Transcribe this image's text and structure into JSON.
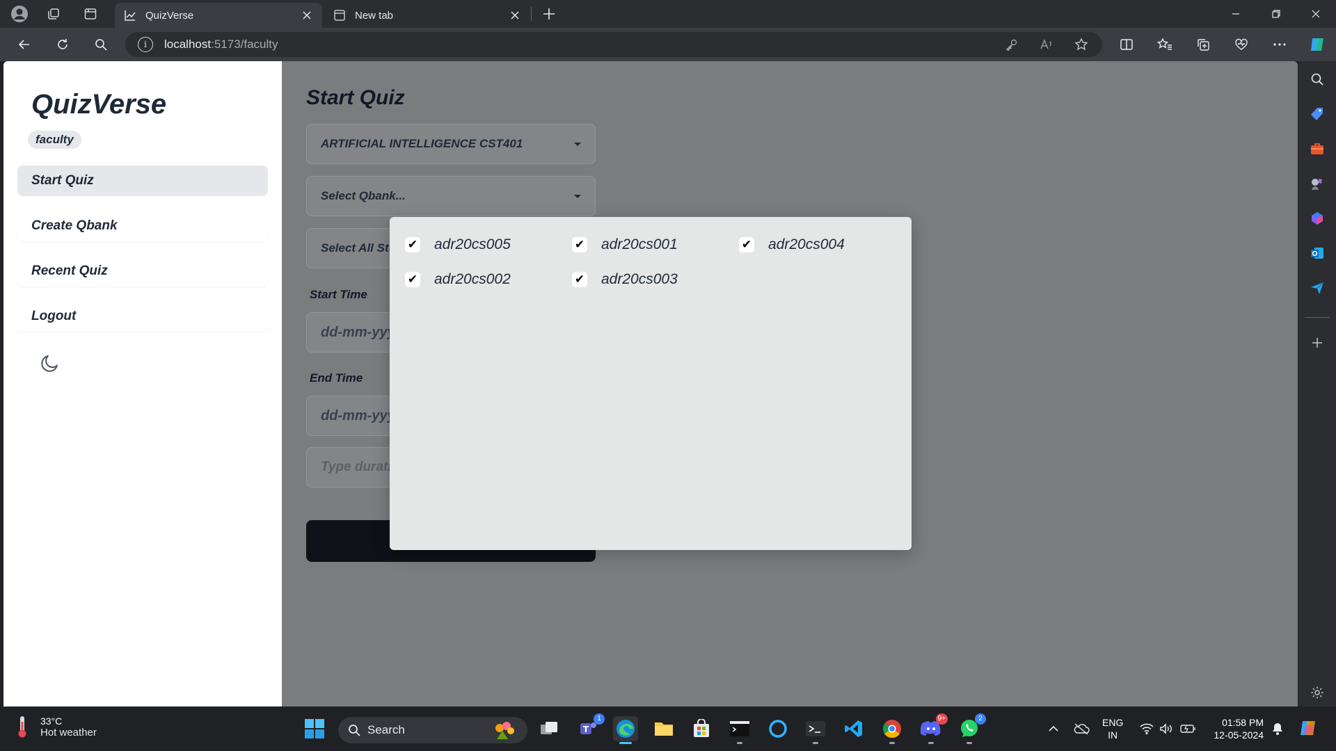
{
  "browser": {
    "tabs": [
      {
        "title": "QuizVerse",
        "active": true
      },
      {
        "title": "New tab",
        "active": false
      }
    ],
    "url_host": "localhost",
    "url_path": ":5173/faculty"
  },
  "sidebar": {
    "brand": "QuizVerse",
    "role": "faculty",
    "items": [
      {
        "label": "Start Quiz",
        "active": true
      },
      {
        "label": "Create Qbank",
        "active": false
      },
      {
        "label": "Recent Quiz",
        "active": false
      },
      {
        "label": "Logout",
        "active": false
      }
    ]
  },
  "main": {
    "title": "Start Quiz",
    "course_select": "ARTIFICIAL INTELLIGENCE CST401",
    "qbank_select": "Select Qbank...",
    "students_select": "Select All Stud",
    "start_time_label": "Start Time",
    "start_time_value": "dd-mm-yyy",
    "end_time_label": "End Time",
    "end_time_value": "dd-mm-yyy",
    "duration_placeholder": "Type durati"
  },
  "modal": {
    "students": [
      {
        "id": "adr20cs005",
        "checked": true
      },
      {
        "id": "adr20cs001",
        "checked": true
      },
      {
        "id": "adr20cs004",
        "checked": true
      },
      {
        "id": "adr20cs002",
        "checked": true
      },
      {
        "id": "adr20cs003",
        "checked": true
      }
    ]
  },
  "taskbar": {
    "weather_temp": "33°C",
    "weather_cond": "Hot weather",
    "search_label": "Search",
    "teams_badge": "1",
    "discord_badge": "9+",
    "whatsapp_badge": "2",
    "lang_top": "ENG",
    "lang_bottom": "IN",
    "time": "01:58 PM",
    "date": "12-05-2024"
  },
  "colors": {
    "accent": "#0e1117",
    "overlay_bg": "#7b7c7e",
    "modal_bg": "#e5e6e6"
  }
}
